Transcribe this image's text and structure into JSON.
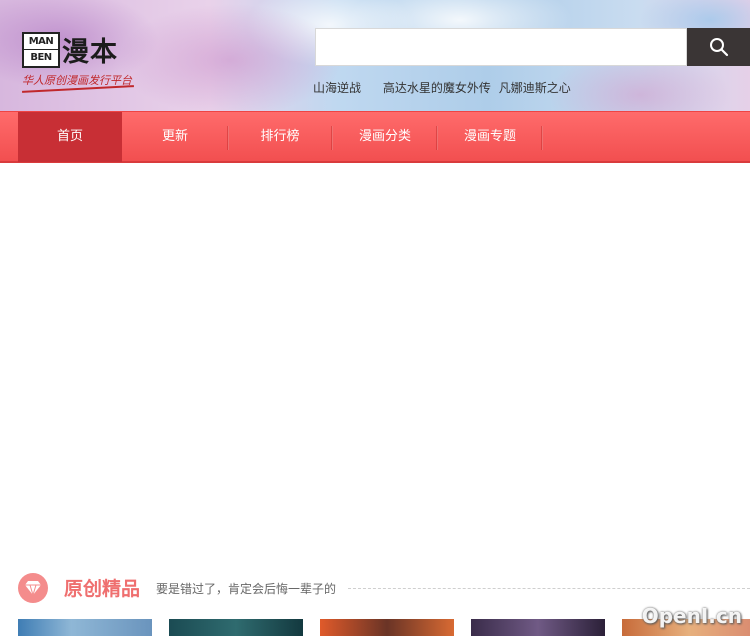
{
  "logo": {
    "box_top": "MAN",
    "box_bottom": "BEN",
    "name": "漫本",
    "slogan": "华人原创漫画发行平台"
  },
  "search": {
    "value": "",
    "placeholder": "",
    "button_icon": "search-icon"
  },
  "hot_links": [
    "山海逆战",
    "高达水星的魔女外传",
    "凡娜迪斯之心"
  ],
  "nav": {
    "items": [
      "首页",
      "更新",
      "排行榜",
      "漫画分类",
      "漫画专题"
    ],
    "active_index": 0
  },
  "section": {
    "icon": "diamond-icon",
    "title": "原创精品",
    "subtitle": "要是错过了，肯定会后悔一辈子的"
  },
  "watermark": "OpenI.cn",
  "colors": {
    "nav_bg": "#f24f50",
    "nav_active": "#c82f35",
    "section_accent": "#ef6f6f",
    "search_button": "#3a3535"
  }
}
